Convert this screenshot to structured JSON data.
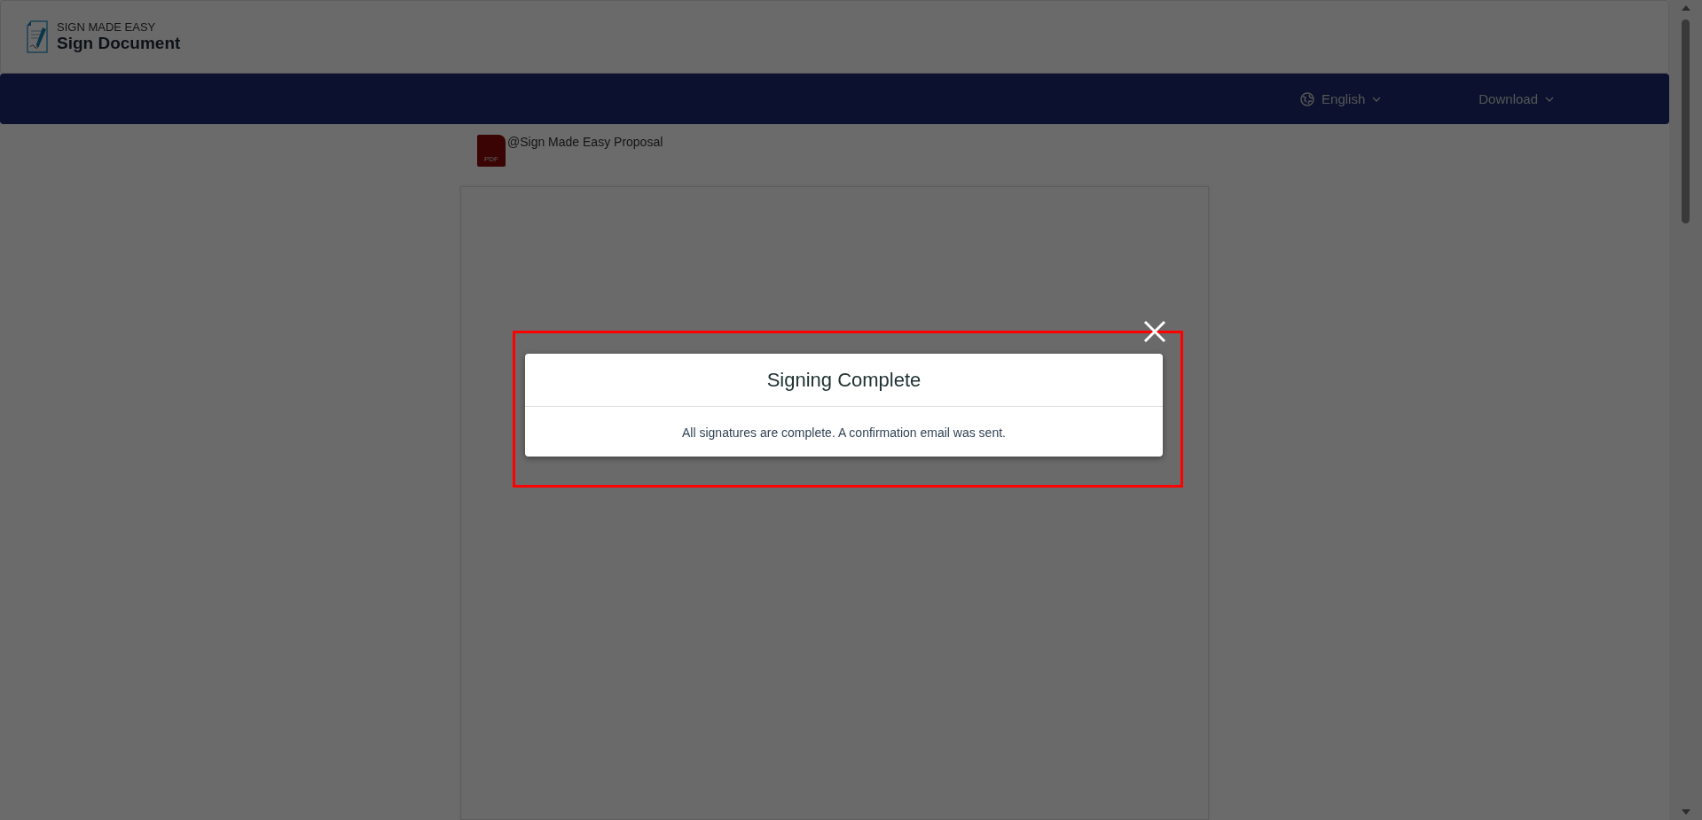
{
  "header": {
    "brand": "SIGN MADE EASY",
    "title": "Sign Document"
  },
  "navbar": {
    "items": [
      {
        "kind": "language",
        "label": "English"
      },
      {
        "kind": "menu",
        "label": "Download"
      }
    ]
  },
  "document": {
    "file_type": "PDF",
    "file_name": "@Sign Made Easy Proposal"
  },
  "dialog": {
    "title": "Signing Complete",
    "message": "All signatures are complete. A confirmation email was sent."
  }
}
